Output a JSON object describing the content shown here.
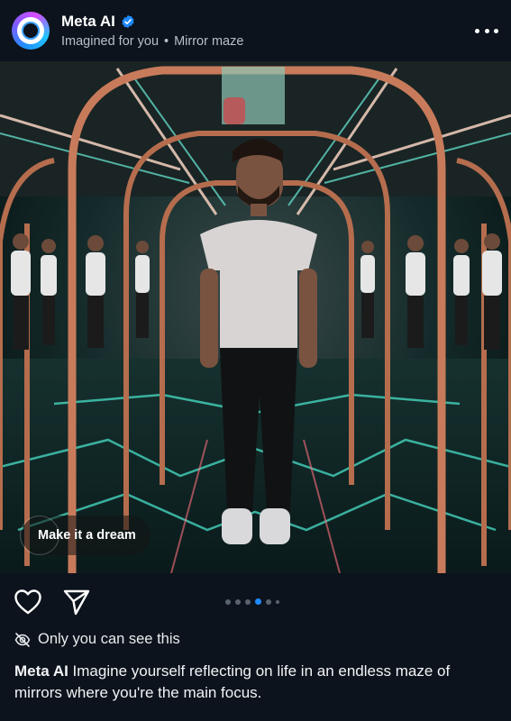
{
  "header": {
    "account_name": "Meta AI",
    "verified": true,
    "subtitle_source": "Imagined for you",
    "subtitle_separator": "•",
    "subtitle_prompt": "Mirror maze"
  },
  "image": {
    "overlay_button": "Make it a dream"
  },
  "actions": {
    "like_icon": "heart-icon",
    "share_icon": "send-icon",
    "pager_total": 6,
    "pager_active_index": 3
  },
  "privacy": {
    "icon": "eye-off-icon",
    "label": "Only you can see this"
  },
  "caption": {
    "author": "Meta AI",
    "text": " Imagine yourself reflecting on life in an endless maze of mirrors where you're the main focus."
  },
  "colors": {
    "background": "#0c131c",
    "accent_blue": "#1f8bff",
    "frame_copper": "#c77b5b",
    "glow_teal": "#3fd9c2"
  }
}
